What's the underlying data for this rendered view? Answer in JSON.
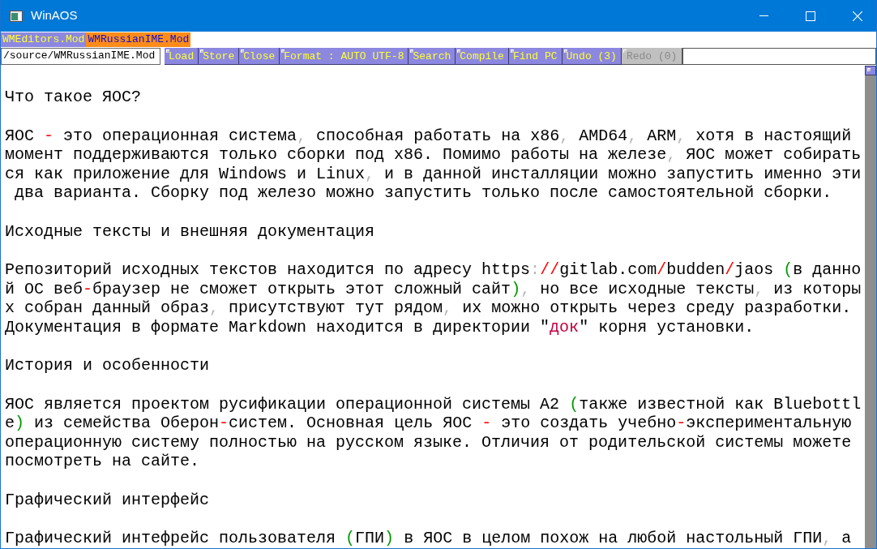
{
  "window": {
    "title": "WinAOS"
  },
  "tabs": [
    {
      "label": "WMEditors.Mod",
      "selected": false
    },
    {
      "label": "WMRussianIME.Mod",
      "selected": true
    }
  ],
  "toolbar": {
    "path": "/source/WMRussianIME.Mod",
    "buttons": [
      {
        "label": "Load",
        "disabled": false
      },
      {
        "label": "Store",
        "disabled": false
      },
      {
        "label": "Close",
        "disabled": false
      },
      {
        "label": "Format : AUTO UTF-8",
        "disabled": false
      },
      {
        "label": "Search",
        "disabled": false
      },
      {
        "label": "Compile",
        "disabled": false
      },
      {
        "label": "Find PC",
        "disabled": false
      },
      {
        "label": "Undo (3)",
        "disabled": false
      },
      {
        "label": "Redo (0)",
        "disabled": true
      }
    ]
  },
  "document": {
    "blocks": [
      {
        "lines": [
          [
            {
              "text": "Что такое ЯОС?"
            }
          ]
        ]
      },
      {
        "lines": [
          [
            {
              "text": "ЯОС "
            },
            {
              "text": "-",
              "color": "#ff0000"
            },
            {
              "text": " это операционная система"
            },
            {
              "text": ",",
              "color": "#b8b8b8"
            },
            {
              "text": " способная работать на x86"
            },
            {
              "text": ",",
              "color": "#b8b8b8"
            },
            {
              "text": " AMD64"
            },
            {
              "text": ",",
              "color": "#b8b8b8"
            },
            {
              "text": " ARM"
            },
            {
              "text": ",",
              "color": "#b8b8b8"
            },
            {
              "text": " хотя в настоящий"
            }
          ],
          [
            {
              "text": "момент поддерживаются только сборки под x86. Помимо работы на железе"
            },
            {
              "text": ",",
              "color": "#b8b8b8"
            },
            {
              "text": " ЯОС может собирать"
            }
          ],
          [
            {
              "text": "ся как приложение для Windows и Linux"
            },
            {
              "text": ",",
              "color": "#b8b8b8"
            },
            {
              "text": " и в данной инсталляции можно запустить именно эти"
            }
          ],
          [
            {
              "text": " два варианта. Сборку под железо можно запустить только после самостоятельной сборки."
            }
          ]
        ]
      },
      {
        "lines": [
          [
            {
              "text": "Исходные тексты и внешняя документация"
            }
          ]
        ]
      },
      {
        "lines": [
          [
            {
              "text": "Репозиторий исходных текстов находится по адресу https"
            },
            {
              "text": ":",
              "color": "#b8b8b8"
            },
            {
              "text": "//",
              "color": "#ff0000"
            },
            {
              "text": "gitlab.com"
            },
            {
              "text": "/",
              "color": "#ff0000"
            },
            {
              "text": "budden"
            },
            {
              "text": "/",
              "color": "#ff0000"
            },
            {
              "text": "jaos "
            },
            {
              "text": "(",
              "color": "#009900"
            },
            {
              "text": "в данно"
            }
          ],
          [
            {
              "text": "й ОС веб"
            },
            {
              "text": "-",
              "color": "#ff0000"
            },
            {
              "text": "браузер не сможет открыть этот сложный сайт"
            },
            {
              "text": ")",
              "color": "#009900"
            },
            {
              "text": ",",
              "color": "#b8b8b8"
            },
            {
              "text": " но все исходные тексты"
            },
            {
              "text": ",",
              "color": "#b8b8b8"
            },
            {
              "text": " из которы"
            }
          ],
          [
            {
              "text": "х собран данный образ"
            },
            {
              "text": ",",
              "color": "#b8b8b8"
            },
            {
              "text": " присутствуют тут рядом"
            },
            {
              "text": ",",
              "color": "#b8b8b8"
            },
            {
              "text": " их можно открыть через среду разработки."
            }
          ],
          [
            {
              "text": "Документация в формате Markdown находится в директории \""
            },
            {
              "text": "док",
              "color": "#c0003c"
            },
            {
              "text": "\" корня установки."
            }
          ]
        ]
      },
      {
        "lines": [
          [
            {
              "text": "История и особенности"
            }
          ]
        ]
      },
      {
        "lines": [
          [
            {
              "text": "ЯОС является проектом русификации операционной системы A2 "
            },
            {
              "text": "(",
              "color": "#009900"
            },
            {
              "text": "также известной как Bluebottl"
            }
          ],
          [
            {
              "text": "е"
            },
            {
              "text": ")",
              "color": "#009900"
            },
            {
              "text": " из семейства Оберон"
            },
            {
              "text": "-",
              "color": "#ff0000"
            },
            {
              "text": "систем. Основная цель ЯОС "
            },
            {
              "text": "-",
              "color": "#ff0000"
            },
            {
              "text": " это создать учебно"
            },
            {
              "text": "-",
              "color": "#ff0000"
            },
            {
              "text": "экспериментальную"
            }
          ],
          [
            {
              "text": "операционную систему полностью на русском языке. Отличия от родительской системы можете"
            }
          ],
          [
            {
              "text": "посмотреть на сайте."
            }
          ]
        ]
      },
      {
        "lines": [
          [
            {
              "text": "Графический интерфейс"
            }
          ]
        ]
      },
      {
        "lines": [
          [
            {
              "text": "Графический интефрейс пользователя "
            },
            {
              "text": "(",
              "color": "#009900"
            },
            {
              "text": "ГПИ"
            },
            {
              "text": ")",
              "color": "#009900"
            },
            {
              "text": " в ЯОС в целом похож на любой настольный ГПИ"
            },
            {
              "text": ",",
              "color": "#b8b8b8"
            },
            {
              "text": " а"
            }
          ]
        ]
      }
    ]
  }
}
